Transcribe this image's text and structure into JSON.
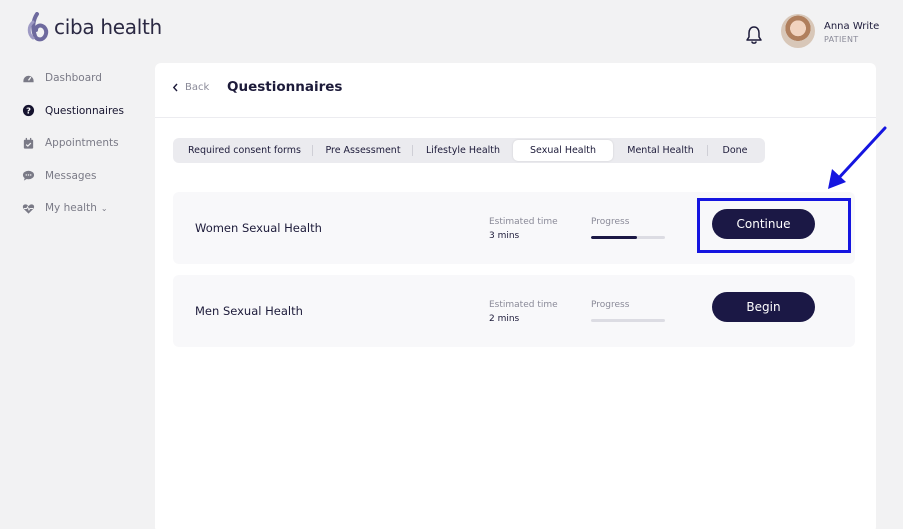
{
  "app": {
    "brand": "ciba health"
  },
  "user": {
    "name": "Anna Write",
    "role": "PATIENT"
  },
  "sidebar": {
    "items": [
      {
        "label": "Dashboard",
        "icon": "dashboard-icon",
        "active": false
      },
      {
        "label": "Questionnaires",
        "icon": "question-icon",
        "active": true
      },
      {
        "label": "Appointments",
        "icon": "calendar-icon",
        "active": false
      },
      {
        "label": "Messages",
        "icon": "chat-icon",
        "active": false
      },
      {
        "label": "My health",
        "icon": "heart-pulse-icon",
        "active": false
      }
    ]
  },
  "header": {
    "back_label": "Back",
    "title": "Questionnaires"
  },
  "tabs": [
    {
      "label": "Required consent forms",
      "active": false
    },
    {
      "label": "Pre Assessment",
      "active": false
    },
    {
      "label": "Lifestyle Health",
      "active": false
    },
    {
      "label": "Sexual Health",
      "active": true
    },
    {
      "label": "Mental Health",
      "active": false
    },
    {
      "label": "Done",
      "active": false
    }
  ],
  "questionnaires": [
    {
      "name": "Women Sexual Health",
      "est_label": "Estimated time",
      "est_value": "3 mins",
      "progress_label": "Progress",
      "progress": 0.62,
      "action": "Continue"
    },
    {
      "name": "Men Sexual Health",
      "est_label": "Estimated time",
      "est_value": "2 mins",
      "progress_label": "Progress",
      "progress": 0,
      "action": "Begin"
    }
  ],
  "colors": {
    "accent": "#1b1845",
    "highlight": "#1515e0",
    "background": "#f2f2f3"
  }
}
